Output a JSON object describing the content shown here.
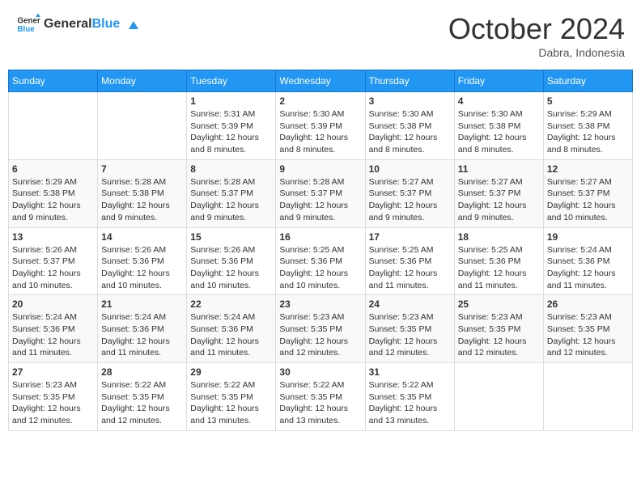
{
  "header": {
    "logo_line1": "General",
    "logo_line2": "Blue",
    "month": "October 2024",
    "location": "Dabra, Indonesia"
  },
  "days_of_week": [
    "Sunday",
    "Monday",
    "Tuesday",
    "Wednesday",
    "Thursday",
    "Friday",
    "Saturday"
  ],
  "weeks": [
    [
      {
        "day": "",
        "info": ""
      },
      {
        "day": "",
        "info": ""
      },
      {
        "day": "1",
        "info": "Sunrise: 5:31 AM\nSunset: 5:39 PM\nDaylight: 12 hours and 8 minutes."
      },
      {
        "day": "2",
        "info": "Sunrise: 5:30 AM\nSunset: 5:39 PM\nDaylight: 12 hours and 8 minutes."
      },
      {
        "day": "3",
        "info": "Sunrise: 5:30 AM\nSunset: 5:38 PM\nDaylight: 12 hours and 8 minutes."
      },
      {
        "day": "4",
        "info": "Sunrise: 5:30 AM\nSunset: 5:38 PM\nDaylight: 12 hours and 8 minutes."
      },
      {
        "day": "5",
        "info": "Sunrise: 5:29 AM\nSunset: 5:38 PM\nDaylight: 12 hours and 8 minutes."
      }
    ],
    [
      {
        "day": "6",
        "info": "Sunrise: 5:29 AM\nSunset: 5:38 PM\nDaylight: 12 hours and 9 minutes."
      },
      {
        "day": "7",
        "info": "Sunrise: 5:28 AM\nSunset: 5:38 PM\nDaylight: 12 hours and 9 minutes."
      },
      {
        "day": "8",
        "info": "Sunrise: 5:28 AM\nSunset: 5:37 PM\nDaylight: 12 hours and 9 minutes."
      },
      {
        "day": "9",
        "info": "Sunrise: 5:28 AM\nSunset: 5:37 PM\nDaylight: 12 hours and 9 minutes."
      },
      {
        "day": "10",
        "info": "Sunrise: 5:27 AM\nSunset: 5:37 PM\nDaylight: 12 hours and 9 minutes."
      },
      {
        "day": "11",
        "info": "Sunrise: 5:27 AM\nSunset: 5:37 PM\nDaylight: 12 hours and 9 minutes."
      },
      {
        "day": "12",
        "info": "Sunrise: 5:27 AM\nSunset: 5:37 PM\nDaylight: 12 hours and 10 minutes."
      }
    ],
    [
      {
        "day": "13",
        "info": "Sunrise: 5:26 AM\nSunset: 5:37 PM\nDaylight: 12 hours and 10 minutes."
      },
      {
        "day": "14",
        "info": "Sunrise: 5:26 AM\nSunset: 5:36 PM\nDaylight: 12 hours and 10 minutes."
      },
      {
        "day": "15",
        "info": "Sunrise: 5:26 AM\nSunset: 5:36 PM\nDaylight: 12 hours and 10 minutes."
      },
      {
        "day": "16",
        "info": "Sunrise: 5:25 AM\nSunset: 5:36 PM\nDaylight: 12 hours and 10 minutes."
      },
      {
        "day": "17",
        "info": "Sunrise: 5:25 AM\nSunset: 5:36 PM\nDaylight: 12 hours and 11 minutes."
      },
      {
        "day": "18",
        "info": "Sunrise: 5:25 AM\nSunset: 5:36 PM\nDaylight: 12 hours and 11 minutes."
      },
      {
        "day": "19",
        "info": "Sunrise: 5:24 AM\nSunset: 5:36 PM\nDaylight: 12 hours and 11 minutes."
      }
    ],
    [
      {
        "day": "20",
        "info": "Sunrise: 5:24 AM\nSunset: 5:36 PM\nDaylight: 12 hours and 11 minutes."
      },
      {
        "day": "21",
        "info": "Sunrise: 5:24 AM\nSunset: 5:36 PM\nDaylight: 12 hours and 11 minutes."
      },
      {
        "day": "22",
        "info": "Sunrise: 5:24 AM\nSunset: 5:36 PM\nDaylight: 12 hours and 11 minutes."
      },
      {
        "day": "23",
        "info": "Sunrise: 5:23 AM\nSunset: 5:35 PM\nDaylight: 12 hours and 12 minutes."
      },
      {
        "day": "24",
        "info": "Sunrise: 5:23 AM\nSunset: 5:35 PM\nDaylight: 12 hours and 12 minutes."
      },
      {
        "day": "25",
        "info": "Sunrise: 5:23 AM\nSunset: 5:35 PM\nDaylight: 12 hours and 12 minutes."
      },
      {
        "day": "26",
        "info": "Sunrise: 5:23 AM\nSunset: 5:35 PM\nDaylight: 12 hours and 12 minutes."
      }
    ],
    [
      {
        "day": "27",
        "info": "Sunrise: 5:23 AM\nSunset: 5:35 PM\nDaylight: 12 hours and 12 minutes."
      },
      {
        "day": "28",
        "info": "Sunrise: 5:22 AM\nSunset: 5:35 PM\nDaylight: 12 hours and 12 minutes."
      },
      {
        "day": "29",
        "info": "Sunrise: 5:22 AM\nSunset: 5:35 PM\nDaylight: 12 hours and 13 minutes."
      },
      {
        "day": "30",
        "info": "Sunrise: 5:22 AM\nSunset: 5:35 PM\nDaylight: 12 hours and 13 minutes."
      },
      {
        "day": "31",
        "info": "Sunrise: 5:22 AM\nSunset: 5:35 PM\nDaylight: 12 hours and 13 minutes."
      },
      {
        "day": "",
        "info": ""
      },
      {
        "day": "",
        "info": ""
      }
    ]
  ]
}
